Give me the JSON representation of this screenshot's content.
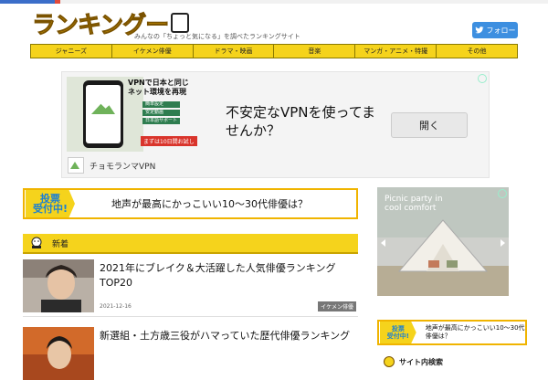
{
  "site": {
    "logo_text": "ランキングー",
    "tagline": "みんなの「ちょっと気になる」を調べたランキングサイト",
    "twitter_label": "フォロー"
  },
  "nav": {
    "items": [
      {
        "label": "ジャニーズ"
      },
      {
        "label": "イケメン俳優"
      },
      {
        "label": "ドラマ・映画"
      },
      {
        "label": "音楽"
      },
      {
        "label": "マンガ・アニメ・特撮"
      },
      {
        "label": "その他"
      }
    ]
  },
  "ad": {
    "image_title": "VPNで日本と同じ\nネット環境を再現",
    "image_list": [
      "簡単設定",
      "安定動画",
      "日本語サポート"
    ],
    "image_button": "まずは10日間お試し",
    "headline": "不安定なVPNを使ってませんか？",
    "open_button": "開く",
    "brand": "チョモランマVPN"
  },
  "vote": {
    "badge": "投票\n受付中!",
    "question": "地声が最高にかっこいい10〜30代俳優は？"
  },
  "new_section": {
    "title": "新着"
  },
  "articles": [
    {
      "title": "2021年にブレイク＆大活躍した人気俳優ランキング TOP20",
      "date": "2021-12-16",
      "tag": "イケメン俳優"
    },
    {
      "title": "新選組・土方歳三役がハマっていた歴代俳優ランキング",
      "date": "",
      "tag": ""
    }
  ],
  "sidebar": {
    "ad_text": "Picnic party in\ncool comfort",
    "vote_badge": "投票\n受付中!",
    "vote_question": "地声が最高にかっこいい10〜30代俳優は？",
    "heading": "サイト内検索"
  },
  "colors": {
    "accent_yellow": "#f5d31c",
    "twitter_blue": "#3d8fe0",
    "vote_blue": "#1a7fd4"
  }
}
